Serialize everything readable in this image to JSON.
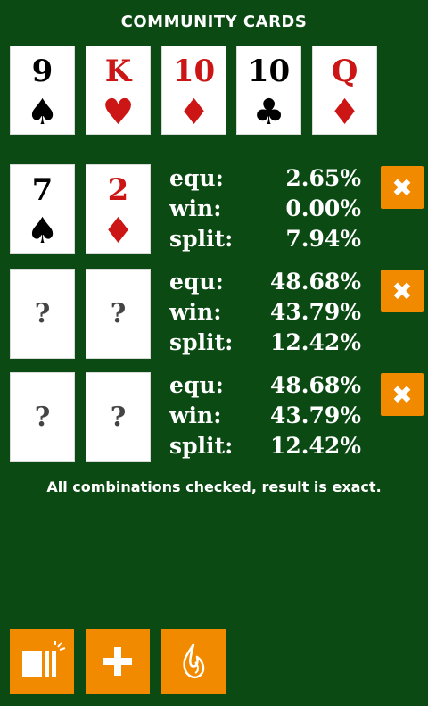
{
  "header": {
    "title": "COMMUNITY CARDS"
  },
  "community": [
    {
      "rank": "9",
      "suit": "♠",
      "suit_name": "spade",
      "color": "black"
    },
    {
      "rank": "K",
      "suit": "♥",
      "suit_name": "heart",
      "color": "red"
    },
    {
      "rank": "10",
      "suit": "♦",
      "suit_name": "diamond",
      "color": "red"
    },
    {
      "rank": "10",
      "suit": "♣",
      "suit_name": "club",
      "color": "black"
    },
    {
      "rank": "Q",
      "suit": "♦",
      "suit_name": "diamond",
      "color": "red"
    }
  ],
  "players": [
    {
      "cards": [
        {
          "rank": "7",
          "suit": "♠",
          "suit_name": "spade",
          "color": "black"
        },
        {
          "rank": "2",
          "suit": "♦",
          "suit_name": "diamond",
          "color": "red"
        }
      ],
      "equ_label": "equ:",
      "equ": "2.65%",
      "win_label": "win:",
      "win": "0.00%",
      "split_label": "split:",
      "split": "7.94%"
    },
    {
      "cards": [
        {
          "rank": "?"
        },
        {
          "rank": "?"
        }
      ],
      "equ_label": "equ:",
      "equ": "48.68%",
      "win_label": "win:",
      "win": "43.79%",
      "split_label": "split:",
      "split": "12.42%"
    },
    {
      "cards": [
        {
          "rank": "?"
        },
        {
          "rank": "?"
        }
      ],
      "equ_label": "equ:",
      "equ": "48.68%",
      "win_label": "win:",
      "win": "43.79%",
      "split_label": "split:",
      "split": "12.42%"
    }
  ],
  "remove_glyph": "✖",
  "status": "All combinations checked, result is exact.",
  "toolbar": [
    {
      "icon": "deck-icon"
    },
    {
      "icon": "plus-icon"
    },
    {
      "icon": "flame-icon"
    }
  ],
  "colors": {
    "background": "#0c4a14",
    "accent": "#f28a00",
    "red_suit": "#cc1616"
  }
}
